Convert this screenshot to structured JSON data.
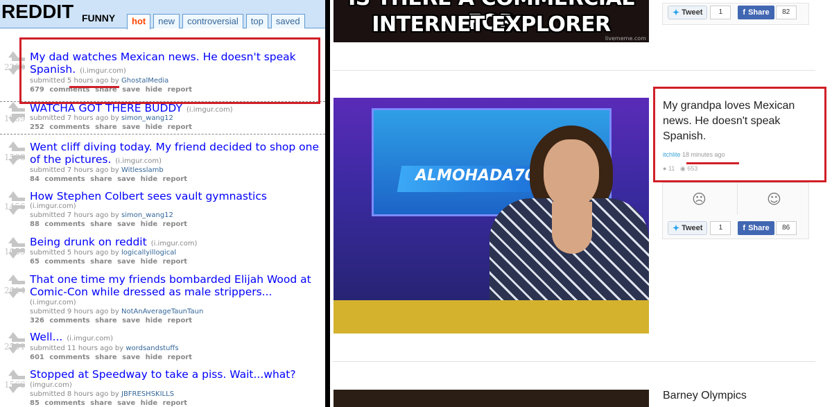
{
  "reddit": {
    "logo": "REDDIT",
    "subreddit": "FUNNY",
    "tabs": [
      "hot",
      "new",
      "controversial",
      "top",
      "saved"
    ],
    "active_tab": "hot",
    "posts": [
      {
        "rank": "2255",
        "title": "My dad watches Mexican news. He doesn't speak Spanish.",
        "domain": "(i.imgur.com)",
        "submitted": "submitted 5 hours ago by",
        "author": "GhostalMedia",
        "comments": "679 comments",
        "actions": "share  save  hide  report"
      },
      {
        "rank": "1989",
        "title": "WATCHA GOT THERE BUDDY",
        "domain": "(i.imgur.com)",
        "submitted": "submitted 7 hours ago by",
        "author": "simon_wang12",
        "comments": "252 comments",
        "actions": "share  save  hide  report"
      },
      {
        "rank": "1508",
        "title": "Went cliff diving today. My friend decided to shop one of the pictures.",
        "domain": "(i.imgur.com)",
        "submitted": "submitted 7 hours ago by",
        "author": "Witlesslamb",
        "comments": "84 comments",
        "actions": "share  save  hide  report"
      },
      {
        "rank": "1456",
        "title": "How Stephen Colbert sees vault gymnastics",
        "domain": "(i.imgur.com)",
        "submitted": "submitted 7 hours ago by",
        "author": "simon_wang12",
        "comments": "88 comments",
        "actions": "share  save  hide  report"
      },
      {
        "rank": "1055",
        "title": "Being drunk on reddit",
        "domain": "(i.imgur.com)",
        "submitted": "submitted 5 hours ago by",
        "author": "logicallyillogical",
        "comments": "65 comments",
        "actions": "share  save  hide  report"
      },
      {
        "rank": "2014",
        "title": "That one time my friends bombarded Elijah Wood at Comic-Con while dressed as male strippers...",
        "domain": "(i.imgur.com)",
        "submitted": "submitted 9 hours ago by",
        "author": "NotAnAverageTaunTaun",
        "comments": "326 comments",
        "actions": "share  save  hide  report"
      },
      {
        "rank": "2501",
        "title": "Well...",
        "domain": "(i.imgur.com)",
        "submitted": "submitted 11 hours ago by",
        "author": "wordsandstuffs",
        "comments": "601 comments",
        "actions": "share  save  hide  report"
      },
      {
        "rank": "1566",
        "title": "Stopped at Speedway to take a piss. Wait...what?",
        "domain": "(imgur.com)",
        "submitted": "submitted 8 hours ago by",
        "author": "JBFRESHSKILLS",
        "comments": "85 comments",
        "actions": "share  save  hide  report"
      }
    ]
  },
  "right": {
    "top_meme_text": "INTERNET EXPLORER",
    "top_meme_text_cut": "IS THERE A COMMERCIAL FOR",
    "watermark": "livememe.com",
    "tweet_label": "Tweet",
    "share_label": "Share",
    "top_tweet_count": "1",
    "top_share_count": "82",
    "tv_banner": "ALMOHADA70",
    "post_title": "My grandpa loves Mexican news. He doesn't speak Spanish.",
    "post_user": "itchlite",
    "post_time": "18 minutes ago",
    "comments_count": "11",
    "views_count": "653",
    "second_tweet_count": "1",
    "second_share_count": "86",
    "next_title": "Barney Olympics",
    "accent_red": "#d01f27"
  }
}
